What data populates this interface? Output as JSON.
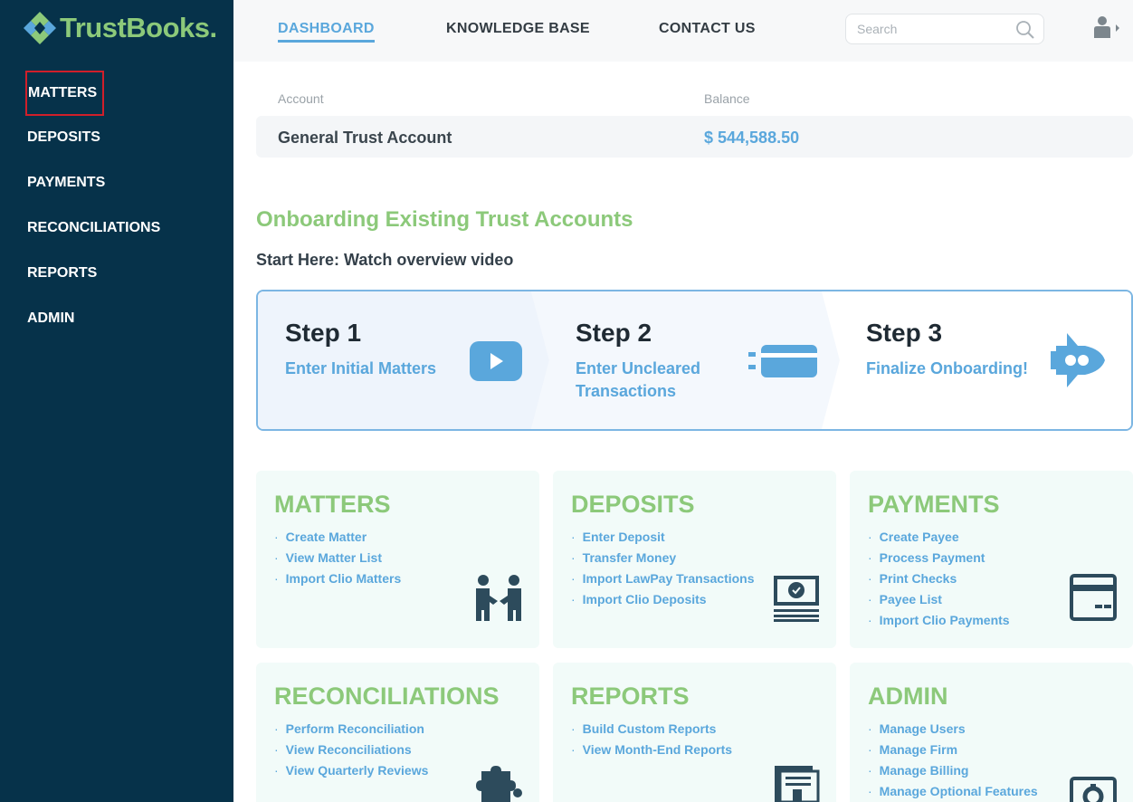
{
  "app": {
    "logo_text": "TrustBooks",
    "logo_suffix": "."
  },
  "sidebar": {
    "items": [
      {
        "label": "MATTERS"
      },
      {
        "label": "DEPOSITS"
      },
      {
        "label": "PAYMENTS"
      },
      {
        "label": "RECONCILIATIONS"
      },
      {
        "label": "REPORTS"
      },
      {
        "label": "ADMIN"
      }
    ]
  },
  "topnav": {
    "dashboard": "DASHBOARD",
    "knowledge_base": "KNOWLEDGE BASE",
    "contact_us": "CONTACT US",
    "active": "DASHBOARD"
  },
  "search": {
    "placeholder": "Search",
    "value": ""
  },
  "account_table": {
    "account_header": "Account",
    "balance_header": "Balance",
    "rows": [
      {
        "account": "General Trust Account",
        "balance": "$ 544,588.50"
      }
    ]
  },
  "onboarding": {
    "title": "Onboarding Existing Trust Accounts",
    "subtitle": "Start Here: Watch overview video",
    "steps": [
      {
        "title": "Step 1",
        "desc_line1": "Enter Initial Matters",
        "desc_line2": "",
        "icon": "video-play-icon"
      },
      {
        "title": "Step 2",
        "desc_line1": "Enter Uncleared",
        "desc_line2": "Transactions",
        "icon": "card-swipe-icon"
      },
      {
        "title": "Step 3",
        "desc_line1": "Finalize Onboarding!",
        "desc_line2": "",
        "icon": "rocket-icon"
      }
    ]
  },
  "cards": [
    {
      "title": "MATTERS",
      "links": [
        "Create Matter",
        "View Matter List",
        "Import Clio Matters"
      ],
      "icon": "handshake-icon"
    },
    {
      "title": "DEPOSITS",
      "links": [
        "Enter Deposit",
        "Transfer Money",
        "Import LawPay Transactions",
        "Import Clio Deposits"
      ],
      "icon": "cash-icon"
    },
    {
      "title": "PAYMENTS",
      "links": [
        "Create Payee",
        "Process Payment",
        "Print Checks",
        "Payee List",
        "Import Clio Payments"
      ],
      "icon": "credit-card-icon"
    },
    {
      "title": "RECONCILIATIONS",
      "links": [
        "Perform Reconciliation",
        "View Reconciliations",
        "View Quarterly Reviews"
      ],
      "icon": "puzzle-icon"
    },
    {
      "title": "REPORTS",
      "links": [
        "Build Custom Reports",
        "View Month-End Reports"
      ],
      "icon": "report-icon"
    },
    {
      "title": "ADMIN",
      "links": [
        "Manage Users",
        "Manage Firm",
        "Manage Billing",
        "Manage Optional Features"
      ],
      "icon": "settings-icon"
    }
  ],
  "colors": {
    "sidebar_bg": "#06324a",
    "brand_green": "#8cc97a",
    "link_blue": "#5aa7dc",
    "card_bg": "#f2fbf9",
    "focus_outline": "#d01f2a"
  }
}
